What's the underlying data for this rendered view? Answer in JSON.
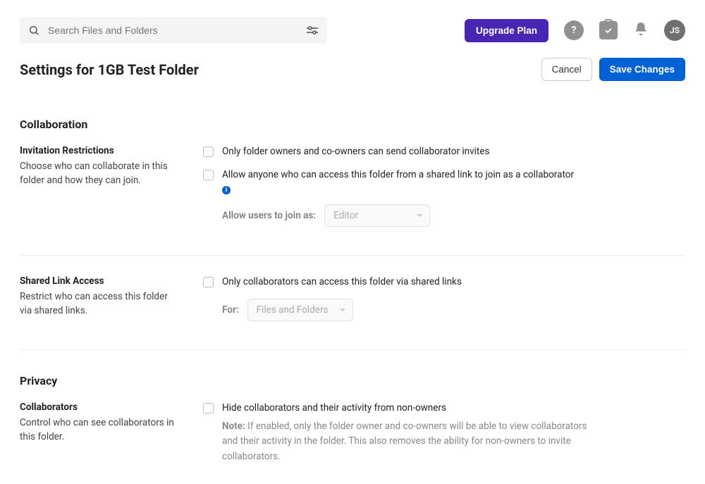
{
  "search": {
    "placeholder": "Search Files and Folders"
  },
  "topbar": {
    "upgrade_label": "Upgrade Plan",
    "avatar_initials": "JS"
  },
  "header": {
    "title": "Settings for 1GB Test Folder",
    "cancel_label": "Cancel",
    "save_label": "Save Changes"
  },
  "sections": {
    "collaboration": {
      "title": "Collaboration",
      "invitation": {
        "label": "Invitation Restrictions",
        "desc": "Choose who can collaborate in this folder and how they can join.",
        "opt1": "Only folder owners and co-owners can send collaborator invites",
        "opt2": "Allow anyone who can access this folder from a shared link to join as a collaborator",
        "join_as_label": "Allow users to join as:",
        "join_as_value": "Editor"
      },
      "shared_link": {
        "label": "Shared Link Access",
        "desc": "Restrict who can access this folder via shared links.",
        "opt1": "Only collaborators can access this folder via shared links",
        "for_label": "For:",
        "for_value": "Files and Folders"
      }
    },
    "privacy": {
      "title": "Privacy",
      "collaborators": {
        "label": "Collaborators",
        "desc": "Control who can see collaborators in this folder.",
        "opt1": "Hide collaborators and their activity from non-owners",
        "note_prefix": "Note:",
        "note_body": " If enabled, only the folder owner and co-owners will be able to view collaborators and their activity in the folder. This also removes the ability for non-owners to invite collaborators."
      }
    }
  }
}
